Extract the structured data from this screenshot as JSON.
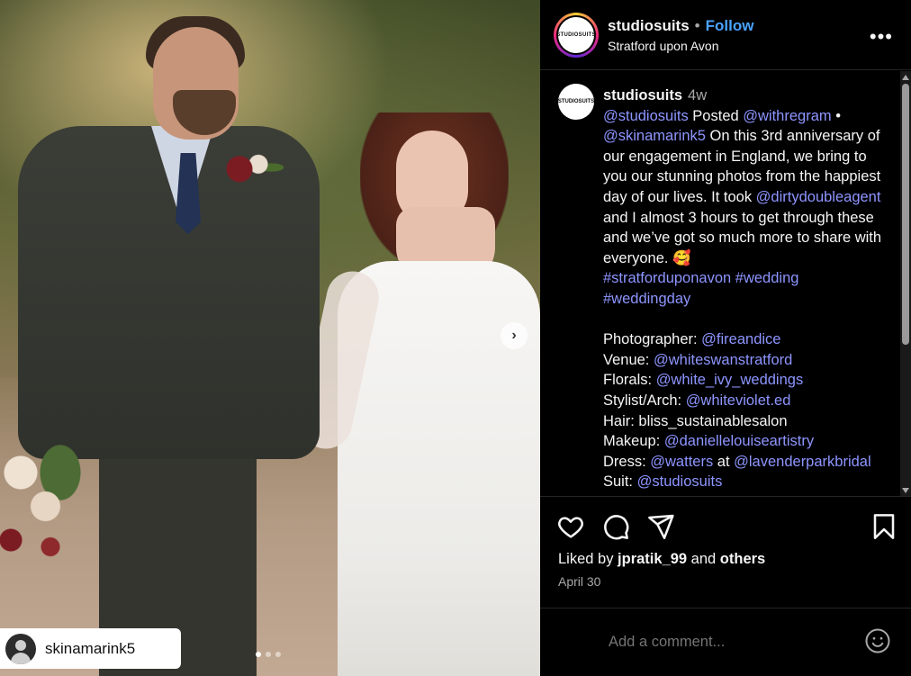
{
  "post": {
    "tagged_user": "skinamarink5",
    "carousel_dots": 3
  },
  "header": {
    "logo_text": "STUDIOSUITS",
    "username": "studiosuits",
    "separator": "•",
    "follow_label": "Follow",
    "location": "Stratford upon Avon",
    "more_label": "•••"
  },
  "caption": {
    "username": "studiosuits",
    "time": "4w",
    "lines": {
      "l1a": "@studiosuits",
      "l1b": " Posted ",
      "l1c": "@withregram",
      "l1d": " • ",
      "l2a": "@skinamarink5",
      "body1": " On this 3rd anniversary of our engagement in England, we bring to you our stunning photos from the happiest day of our lives. It took ",
      "mention_dirty": "@dirtydoubleagent",
      "body2": " and I almost 3 hours to get through these and we’ve got so much more to share with everyone. 🥰",
      "hashtag1": "#stratforduponavon",
      "hashtag2": "#wedding",
      "hashtag3": "#weddingday"
    },
    "credits": [
      {
        "label": "Photographer: ",
        "value": "@fireandice"
      },
      {
        "label": "Venue: ",
        "value": "@whiteswanstratford"
      },
      {
        "label": "Florals: ",
        "value": "@white_ivy_weddings"
      },
      {
        "label": "Stylist/Arch: ",
        "value": "@whiteviolet.ed"
      },
      {
        "label": "Hair: ",
        "value": "bliss_sustainablesalon"
      },
      {
        "label": "Makeup: ",
        "value": "@daniellelouiseartistry"
      },
      {
        "label": "Dress: ",
        "value": "@watters",
        "mid": " at ",
        "value2": "@lavenderparkbridal"
      },
      {
        "label": "Suit: ",
        "value": "@studiosuits"
      }
    ]
  },
  "actions": {
    "like_icon": "heart-icon",
    "comment_icon": "comment-icon",
    "share_icon": "share-icon",
    "save_icon": "bookmark-icon"
  },
  "likes": {
    "prefix": "Liked by ",
    "user": "jpratik_99",
    "middle": " and ",
    "others": "others"
  },
  "date": "April 30",
  "comment": {
    "placeholder": "Add a comment...",
    "emoji_icon": "smiley-icon"
  },
  "colors": {
    "link": "#8d95ff",
    "follow": "#4aa3ff",
    "background": "#000000"
  }
}
